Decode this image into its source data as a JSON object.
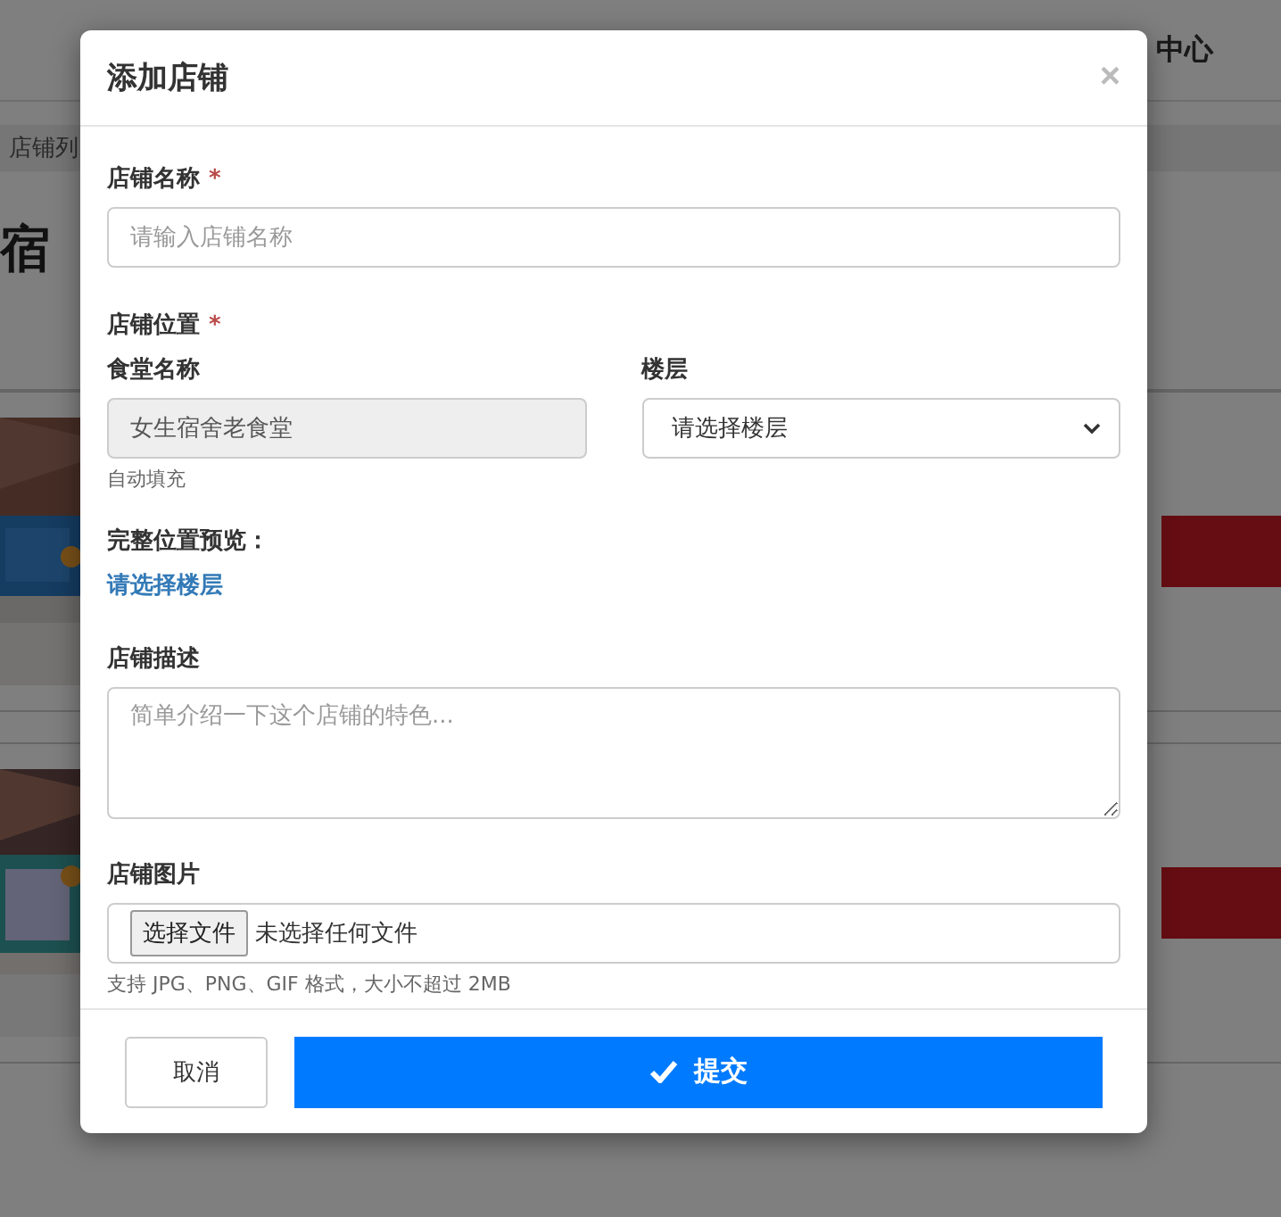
{
  "page": {
    "nav_items": [
      "中心"
    ],
    "breadcrumb": "店铺列",
    "heading": "宿",
    "rows": [
      {
        "kind": "picture"
      },
      {
        "kind": "picture"
      }
    ]
  },
  "dialog": {
    "title": "添加店铺",
    "close": "×",
    "name": {
      "label": "店铺名称",
      "required_mark": "*",
      "placeholder": "请输入店铺名称"
    },
    "location": {
      "label": "店铺位置",
      "required_mark": "*",
      "canteen": {
        "label": "食堂名称",
        "value": "女生宿舍老食堂",
        "disabled": true,
        "hint": "自动填充"
      },
      "floor": {
        "label": "楼层",
        "value": "请选择楼层"
      },
      "preview_label": "完整位置预览：",
      "preview_value": "请选择楼层"
    },
    "description": {
      "label": "店铺描述",
      "placeholder": "简单介绍一下这个店铺的特色..."
    },
    "image": {
      "label": "店铺图片",
      "button": "选择文件",
      "status": "未选择任何文件",
      "hint": "支持 JPG、PNG、GIF 格式，大小不超过 2MB"
    },
    "buttons": {
      "cancel": "取消",
      "submit": "提交"
    }
  }
}
